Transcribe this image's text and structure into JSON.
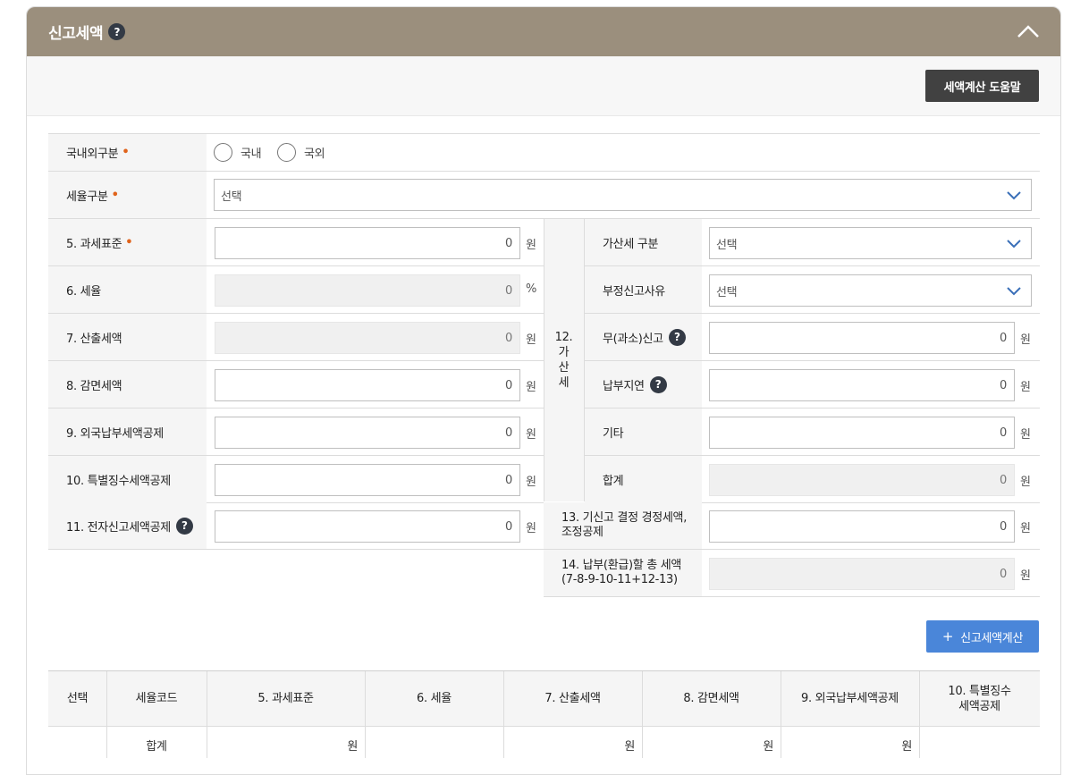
{
  "panel": {
    "title": "신고세액",
    "help_glyph": "?",
    "calc_help_button": "세액계산 도움말"
  },
  "form": {
    "domestic": {
      "label": "국내외구분",
      "req": "•",
      "options": [
        "국내",
        "국외"
      ]
    },
    "tax_type": {
      "label": "세율구분",
      "req": "•",
      "value": "선택"
    },
    "left_rows": [
      {
        "label": "5. 과세표준",
        "req": "•",
        "value": "0",
        "unit": "원"
      },
      {
        "label": "6. 세율",
        "value": "0",
        "unit": "%"
      },
      {
        "label": "7. 산출세액",
        "value": "0",
        "unit": "원"
      },
      {
        "label": "8. 감면세액",
        "value": "0",
        "unit": "원"
      },
      {
        "label": "9. 외국납부세액공제",
        "value": "0",
        "unit": "원"
      },
      {
        "label": "10. 특별징수세액공제",
        "value": "0",
        "unit": "원"
      },
      {
        "label": "11. 전자신고세액공제",
        "value": "0",
        "unit": "원"
      }
    ],
    "penalty_group_label": "12.\n가\n산\n세",
    "right_rows": [
      {
        "label": "가산세 구분",
        "value": "선택"
      },
      {
        "label": "부정신고사유",
        "value": "선택"
      },
      {
        "label": "무(과소)신고",
        "value": "0",
        "unit": "원"
      },
      {
        "label": "납부지연",
        "value": "0",
        "unit": "원"
      },
      {
        "label": "기타",
        "value": "0",
        "unit": "원"
      },
      {
        "label": "합계",
        "value": "0",
        "unit": "원"
      }
    ],
    "row13": {
      "label": "13. 기신고 결정 경정세액,\n조정공제",
      "value": "0",
      "unit": "원"
    },
    "row14": {
      "label": "14. 납부(환급)할 총 세액\n(7-8-9-10-11+12-13)",
      "value": "0",
      "unit": "원"
    },
    "calc_button": "신고세액계산",
    "calc_button_icon": "+"
  },
  "table": {
    "headers": [
      "선택",
      "세율코드",
      "5. 과세표준",
      "6. 세율",
      "7. 산출세액",
      "8. 감면세액",
      "9. 외국납부세액공제",
      "10. 특별징수\n세액공제"
    ],
    "total_row": {
      "label": "합계",
      "c5_unit": "원",
      "c7_unit": "원",
      "c8_unit": "원",
      "c9_unit": "원"
    }
  }
}
